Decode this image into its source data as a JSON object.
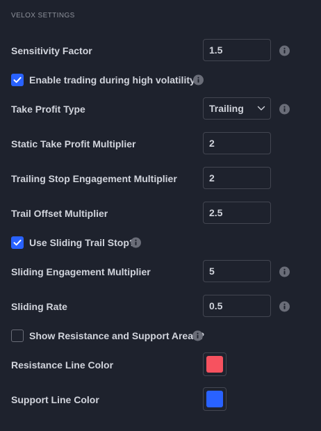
{
  "section": {
    "title": "VELOX SETTINGS"
  },
  "settings": {
    "sensitivity": {
      "label": "Sensitivity Factor",
      "value": "1.5"
    },
    "high_volatility": {
      "label": "Enable trading during high volatility",
      "checked": true
    },
    "take_profit_type": {
      "label": "Take Profit Type",
      "value": "Trailing"
    },
    "static_tp": {
      "label": "Static Take Profit Multiplier",
      "value": "2"
    },
    "trailing_stop": {
      "label": "Trailing Stop Engagement Multiplier",
      "value": "2"
    },
    "trail_offset": {
      "label": "Trail Offset Multiplier",
      "value": "2.5"
    },
    "sliding_trail": {
      "label": "Use Sliding Trail Stop?",
      "checked": true
    },
    "sliding_engagement": {
      "label": "Sliding Engagement Multiplier",
      "value": "5"
    },
    "sliding_rate": {
      "label": "Sliding Rate",
      "value": "0.5"
    },
    "show_areas": {
      "label": "Show Resistance and Support Areas?",
      "checked": false
    },
    "resistance_color": {
      "label": "Resistance Line Color",
      "color": "#f7525f"
    },
    "support_color": {
      "label": "Support Line Color",
      "color": "#2962ff"
    }
  },
  "icons": {
    "info": "info-icon",
    "check": "checkmark-icon",
    "chevron": "chevron-down-icon"
  },
  "colors": {
    "accent": "#2962ff",
    "background": "#1e222d"
  }
}
